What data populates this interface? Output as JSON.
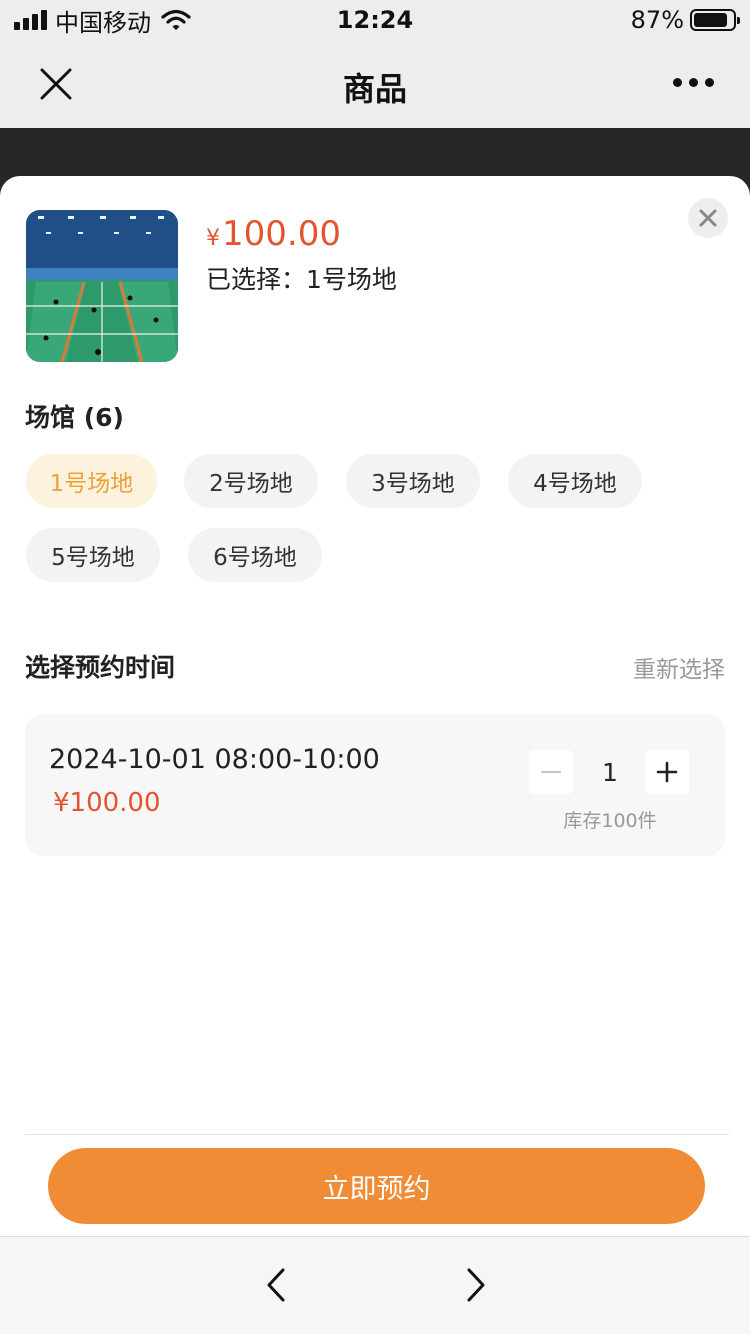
{
  "status_bar": {
    "carrier": "中国移动",
    "time": "12:24",
    "battery_text": "87%",
    "battery_level": 0.87
  },
  "nav": {
    "title": "商品"
  },
  "product": {
    "currency": "¥",
    "price": "100.00",
    "selected_text": "已选择：1号场地"
  },
  "venue": {
    "title": "场馆 (6)",
    "options": [
      "1号场地",
      "2号场地",
      "3号场地",
      "4号场地",
      "5号场地",
      "6号场地"
    ],
    "selected_index": 0
  },
  "booking": {
    "title": "选择预约时间",
    "reselect_label": "重新选择",
    "slot_time": "2024-10-01 08:00-10:00",
    "slot_price": "¥100.00",
    "quantity": "1",
    "stock": "库存100件"
  },
  "action": {
    "book_label": "立即预约"
  },
  "colors": {
    "accent": "#f08c35",
    "price": "#e2552f",
    "chip_active_bg": "#fdf2dd",
    "chip_active_text": "#efa138"
  }
}
